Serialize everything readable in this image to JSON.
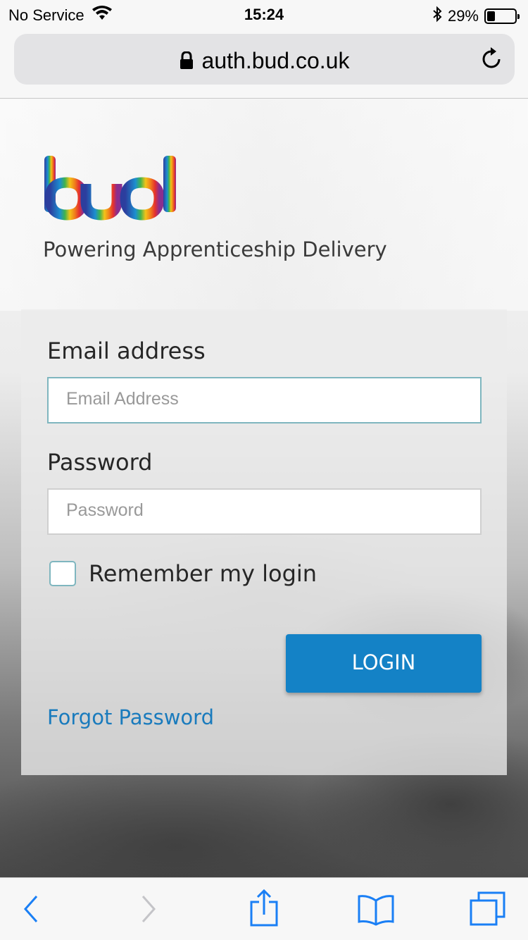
{
  "status_bar": {
    "carrier": "No Service",
    "time": "15:24",
    "battery_percent": "29%",
    "battery_level": 0.29,
    "icons": [
      "wifi-icon",
      "bluetooth-icon",
      "battery-icon"
    ]
  },
  "browser": {
    "url": "auth.bud.co.uk",
    "icons": [
      "lock-icon",
      "reload-icon"
    ]
  },
  "page": {
    "logo_text": "bud",
    "tagline": "Powering Apprenticeship Delivery",
    "form": {
      "email_label": "Email address",
      "email_placeholder": "Email Address",
      "email_value": "",
      "password_label": "Password",
      "password_placeholder": "Password",
      "password_value": "",
      "remember_label": "Remember my login",
      "remember_checked": false,
      "login_button": "LOGIN",
      "forgot_password": "Forgot Password"
    }
  },
  "toolbar": {
    "icons": [
      "back-icon",
      "forward-icon",
      "share-icon",
      "bookmarks-icon",
      "tabs-icon"
    ]
  },
  "colors": {
    "accent": "#1482c6",
    "link": "#1a7bbd",
    "input_focus_border": "#7fb6bf"
  }
}
